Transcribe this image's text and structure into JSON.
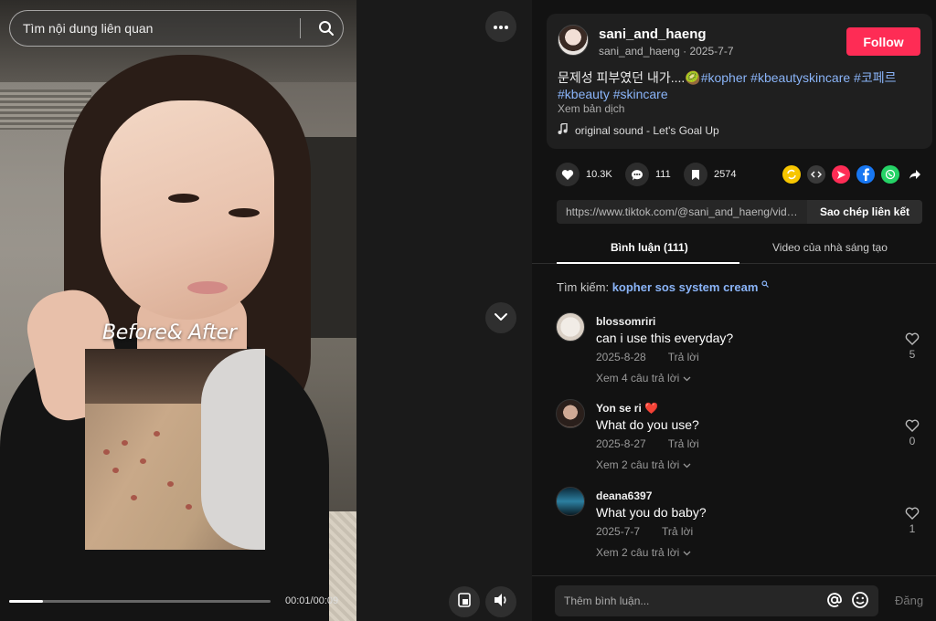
{
  "search": {
    "placeholder": "Tìm nội dung liên quan"
  },
  "video": {
    "overlay_text": "Before& After",
    "time": "00:01/00:09",
    "progress_fraction": 0.13
  },
  "author": {
    "username": "sani_and_haeng",
    "handle": "sani_and_haeng",
    "date": "2025-7-7",
    "follow_label": "Follow",
    "description_prefix": "문제성 피부였던 내가....🥝",
    "hashtags_line1": "#kopher #kbeautyskincare #코페르",
    "hashtags_line2": "#kbeauty #skincare",
    "translate_label": "Xem bản dịch",
    "sound": "original sound - Let's Goal Up"
  },
  "actions": {
    "likes": "10.3K",
    "comments": "111",
    "saves": "2574"
  },
  "share": {
    "url": "https://www.tiktok.com/@sani_and_haeng/vide...",
    "copy_label": "Sao chép liên kết"
  },
  "tabs": {
    "comments": "Bình luận (111)",
    "creator_videos": "Video của nhà sáng tạo"
  },
  "suggest": {
    "prefix": "Tìm kiếm:",
    "keyword": "kopher sos system cream"
  },
  "comments": [
    {
      "user": "blossomriri",
      "text": "can i use this everyday?",
      "date": "2025-8-28",
      "reply": "Trả lời",
      "replies": "Xem 4 câu trả lời",
      "likes": "5"
    },
    {
      "user": "Yon se ri ❤️",
      "text": "What do you use?",
      "date": "2025-8-27",
      "reply": "Trả lời",
      "replies": "Xem 2 câu trả lời",
      "likes": "0"
    },
    {
      "user": "deana6397",
      "text": "What you do baby?",
      "date": "2025-7-7",
      "reply": "Trả lời",
      "replies": "Xem 2 câu trả lời",
      "likes": "1"
    }
  ],
  "composer": {
    "placeholder": "Thêm bình luận...",
    "post_label": "Đăng"
  },
  "colors": {
    "follow": "#fe2c55",
    "link": "#8ab4f8",
    "panel": "#121212",
    "card": "#1f1f1f"
  },
  "icons": [
    "search-icon",
    "more-icon",
    "chevron-down-icon",
    "floating-player-icon",
    "volume-icon",
    "music-note-icon",
    "heart-icon",
    "comment-icon",
    "bookmark-icon",
    "repost-icon",
    "embed-icon",
    "send-icon",
    "facebook-icon",
    "whatsapp-icon",
    "share-arrow-icon",
    "at-icon",
    "emoji-icon"
  ]
}
